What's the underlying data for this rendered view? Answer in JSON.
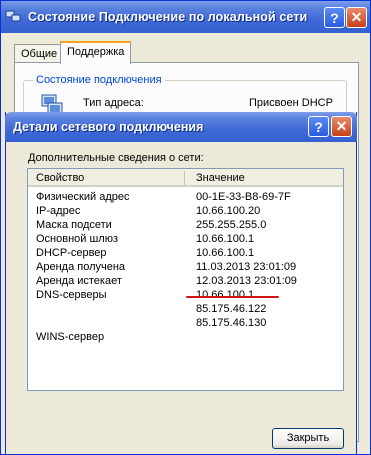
{
  "back_window": {
    "title": "Состояние Подключение по локальной сети",
    "help_glyph": "?",
    "close_glyph": "✕",
    "tabs": [
      {
        "label": "Общие",
        "active": false
      },
      {
        "label": "Поддержка",
        "active": true
      }
    ],
    "group_title": "Состояние подключения",
    "address_type_label": "Тип адреса:",
    "address_type_value": "Присвоен DHCP"
  },
  "dialog": {
    "title": "Детали сетевого подключения",
    "help_glyph": "?",
    "close_glyph": "✕",
    "caption": "Дополнительные сведения о сети:",
    "columns": {
      "property": "Свойство",
      "value": "Значение"
    },
    "rows": [
      {
        "property": "Физический адрес",
        "value": "00-1E-33-B8-69-7F"
      },
      {
        "property": "IP-адрес",
        "value": "10.66.100.20"
      },
      {
        "property": "Маска подсети",
        "value": "255.255.255.0"
      },
      {
        "property": "Основной шлюз",
        "value": "10.66.100.1"
      },
      {
        "property": "DHCP-сервер",
        "value": "10.66.100.1"
      },
      {
        "property": "Аренда получена",
        "value": "11.03.2013 23:01:09"
      },
      {
        "property": "Аренда истекает",
        "value": "12.03.2013 23:01:09"
      },
      {
        "property": "DNS-серверы",
        "value": "10.66.100.1"
      },
      {
        "property": "",
        "value": "85.175.46.122"
      },
      {
        "property": "",
        "value": "85.175.46.130"
      },
      {
        "property": "WINS-сервер",
        "value": ""
      }
    ],
    "close_button": "Закрыть"
  },
  "colors": {
    "title_bar": "#3561d0",
    "window_bg": "#ece9d8",
    "group_title": "#0046d5",
    "annotation_underline": "#d01414"
  },
  "icons": [
    "network-connection-icon",
    "help-icon",
    "close-icon"
  ]
}
